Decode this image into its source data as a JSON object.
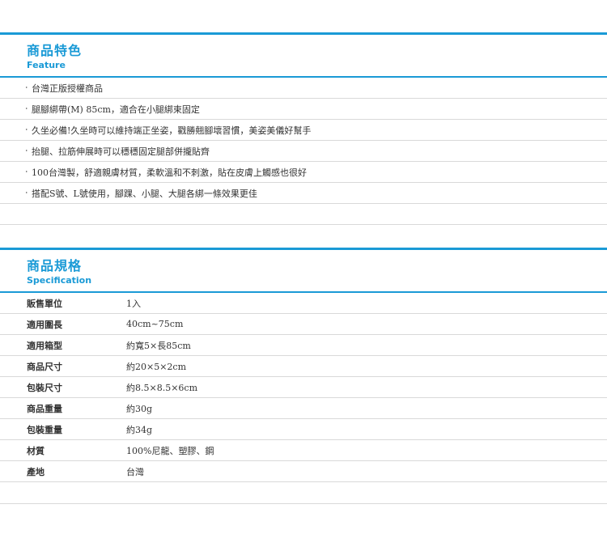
{
  "feature": {
    "title": "商品特色",
    "subtitle": "Feature",
    "items": [
      "台灣正版授權商品",
      "腿腳綁帶(M) 85cm，適合在小腿綁束固定",
      "久坐必備!久坐時可以維持端正坐姿，戳勝翹腳壞習慣，美姿美儀好幫手",
      "抬腿、拉筋伸展時可以穩穩固定腿部併攏貼齊",
      "100台灣製，舒適親膚材質，柔軟溫和不刺激，貼在皮膚上觸感也很好",
      "搭配S號、L號使用，腳踝、小腿、大腿各綁一條效果更佳"
    ],
    "bullet": "‧"
  },
  "spec": {
    "title": "商品規格",
    "subtitle": "Specification",
    "rows": [
      {
        "label": "販售單位",
        "value": "1入"
      },
      {
        "label": "適用圍長",
        "value": "40cm~75cm"
      },
      {
        "label": "適用箱型",
        "value": "約寬5×長85cm"
      },
      {
        "label": "商品尺寸",
        "value": "約20×5×2cm"
      },
      {
        "label": "包裝尺寸",
        "value": "約8.5×8.5×6cm"
      },
      {
        "label": "商品重量",
        "value": "約30g"
      },
      {
        "label": "包裝重量",
        "value": "約34g"
      },
      {
        "label": "材質",
        "value": "100%尼龍、塑膠、鋼"
      },
      {
        "label": "產地",
        "value": "台灣"
      }
    ]
  },
  "colors": {
    "accent": "#1a9ad6",
    "divider": "#d9d9d9",
    "text": "#333333"
  }
}
